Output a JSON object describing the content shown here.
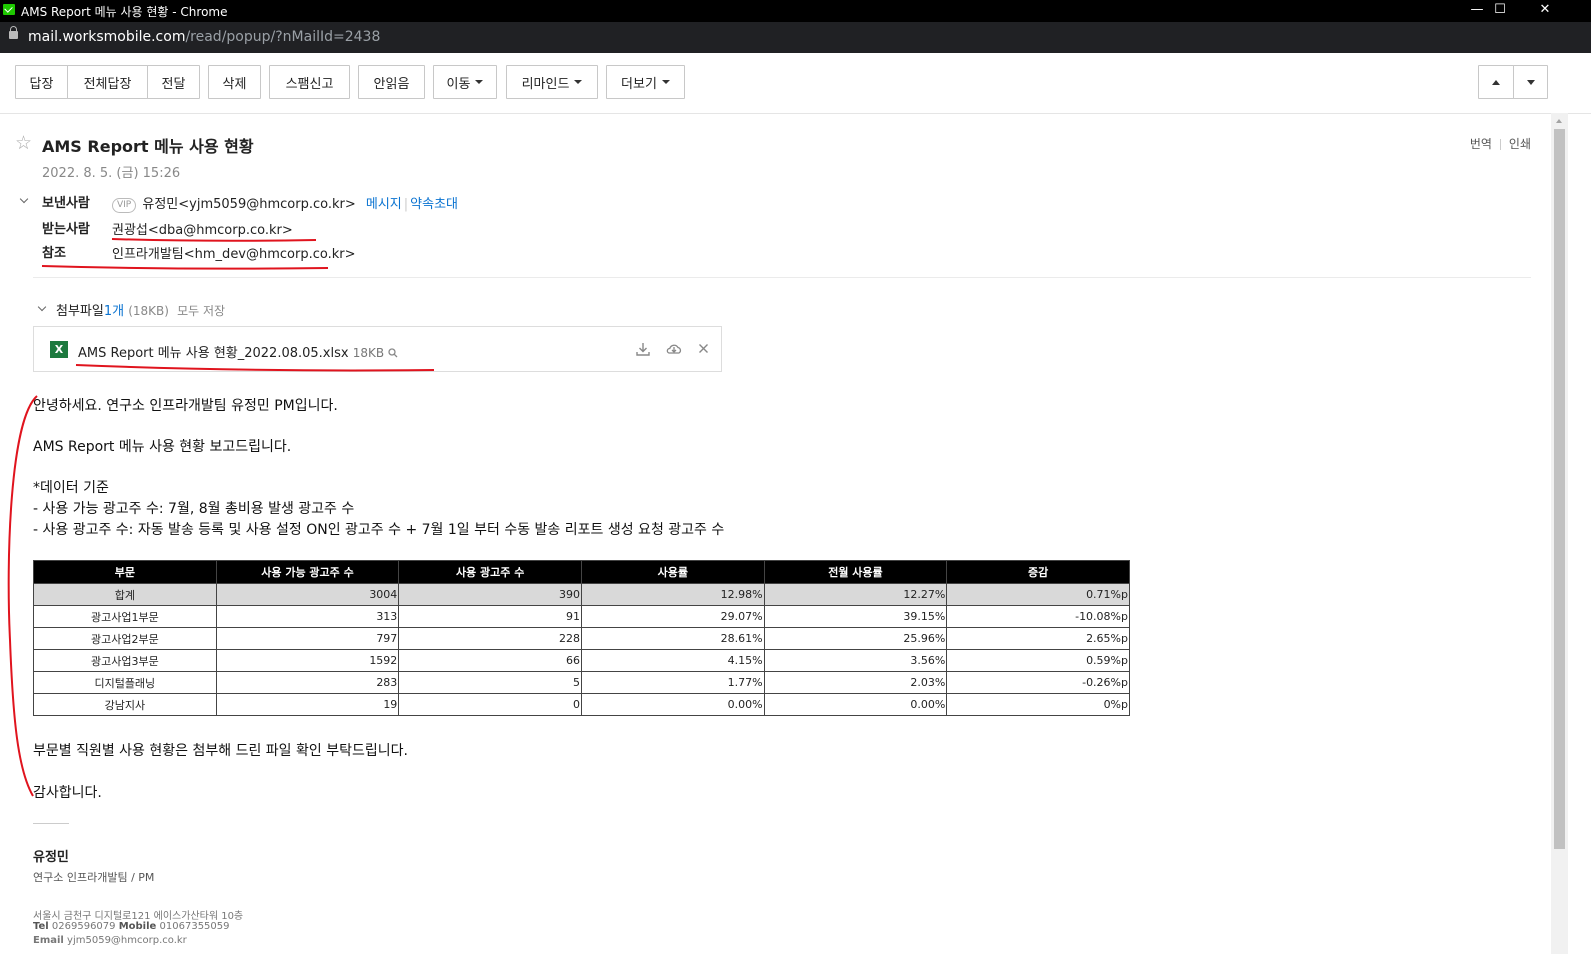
{
  "window": {
    "title": "AMS Report 메뉴 사용 현황 - Chrome"
  },
  "address": {
    "host": "mail.worksmobile.com",
    "path": "/read/popup/?nMailId=2438"
  },
  "toolbar": {
    "reply": "답장",
    "reply_all": "전체답장",
    "forward": "전달",
    "delete": "삭제",
    "spam": "스팸신고",
    "unread": "안읽음",
    "move": "이동",
    "remind": "리마인드",
    "more": "더보기"
  },
  "mail": {
    "subject": "AMS Report 메뉴 사용 현황",
    "date": "2022. 8. 5. (금) 15:26",
    "translate": "번역",
    "print": "인쇄",
    "from_label": "보낸사람",
    "vip": "VIP",
    "from": "유정민<yjm5059@hmcorp.co.kr>",
    "message_link": "메시지",
    "invite_link": "약속초대",
    "to_label": "받는사람",
    "to_name": "권광섭",
    "to_email": "<dba@hmcorp.co.kr>",
    "cc_label": "참조",
    "cc_name": "인프라개발팀",
    "cc_email": "<hm_dev@hmcorp.co.kr>"
  },
  "attachment": {
    "label": "첨부파일",
    "count": "1개",
    "total_size": "(18KB)",
    "save_all": "모두 저장",
    "file_icon": "X",
    "file_name": "AMS Report 메뉴 사용 현황_2022.08.05.xlsx",
    "file_size": "18KB"
  },
  "body": {
    "greeting": "안녕하세요. 연구소 인프라개발팀 유정민 PM입니다.",
    "intro": "AMS Report 메뉴 사용 현황 보고드립니다.",
    "criteria_title": "*데이터 기준",
    "criteria_1": "- 사용 가능 광고주 수: 7월, 8월 총비용 발생 광고주 수",
    "criteria_2": "- 사용 광고주 수: 자동 발송 등록 및 사용 설정 ON인 광고주 수 + 7월 1일 부터 수동 발송 리포트 생성 요청 광고주 수",
    "closing_1": "부문별 직원별 사용 현황은 첨부해 드린 파일 확인 부탁드립니다.",
    "closing_2": "감사합니다."
  },
  "table": {
    "headers": [
      "부문",
      "사용 가능 광고주 수",
      "사용 광고주 수",
      "사용률",
      "전월 사용률",
      "증감"
    ],
    "rows": [
      [
        "합계",
        "3004",
        "390",
        "12.98%",
        "12.27%",
        "0.71%p"
      ],
      [
        "광고사업1부문",
        "313",
        "91",
        "29.07%",
        "39.15%",
        "-10.08%p"
      ],
      [
        "광고사업2부문",
        "797",
        "228",
        "28.61%",
        "25.96%",
        "2.65%p"
      ],
      [
        "광고사업3부문",
        "1592",
        "66",
        "4.15%",
        "3.56%",
        "0.59%p"
      ],
      [
        "디지털플래닝",
        "283",
        "5",
        "1.77%",
        "2.03%",
        "-0.26%p"
      ],
      [
        "강남지사",
        "19",
        "0",
        "0.00%",
        "0.00%",
        "0%p"
      ]
    ]
  },
  "signature": {
    "name": "유정민",
    "dept": "연구소 인프라개발팀 / PM",
    "address": "서울시 금천구 디지털로121 에이스가산타워 10층",
    "tel_label": "Tel",
    "tel": "0269596079",
    "mobile_label": "Mobile",
    "mobile": "01067355059",
    "email_label": "Email",
    "email": "yjm5059@hmcorp.co.kr"
  },
  "colors": {
    "link": "#0a73d1",
    "annotation": "#e0141e",
    "excel": "#1d7a3f"
  }
}
